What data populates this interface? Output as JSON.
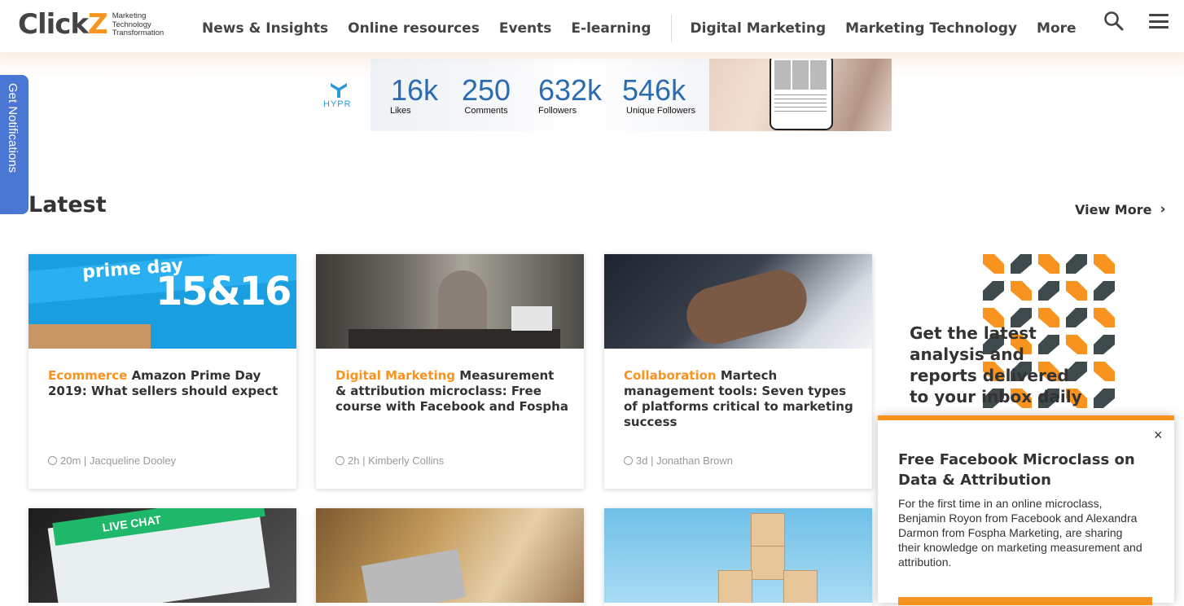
{
  "header": {
    "logo_text": "Click",
    "logo_z": "Z",
    "logo_tagline": [
      "Marketing",
      "Technology",
      "Transformation"
    ],
    "nav": [
      "News & Insights",
      "Online resources",
      "Events",
      "E-learning"
    ],
    "nav_secondary": [
      "Digital Marketing",
      "Marketing Technology",
      "More"
    ],
    "search_icon": "search-icon",
    "menu_icon": "hamburger-menu-icon"
  },
  "banner": {
    "brand": "HYPR",
    "stats": [
      {
        "value": "16k",
        "label": "Likes"
      },
      {
        "value": "250",
        "label": "Comments"
      },
      {
        "value": "632k",
        "label": "Followers"
      },
      {
        "value": "546k",
        "label": "Unique Followers"
      }
    ]
  },
  "notifications_tab": "Get Notifications",
  "section": {
    "title": "Latest",
    "view_more": "View More"
  },
  "cards": [
    {
      "category": "Ecommerce",
      "title": "Amazon Prime Day 2019: What sellers should expect",
      "age": "20m",
      "author": "Jacqueline Dooley"
    },
    {
      "category": "Digital Marketing",
      "title": "Measurement & attribution microclass: Free course with Facebook and Fospha",
      "age": "2h",
      "author": "Kimberly Collins"
    },
    {
      "category": "Collaboration",
      "title": "Martech management tools: Seven types of platforms critical to marketing success",
      "age": "3d",
      "author": "Jonathan Brown"
    }
  ],
  "card_images": {
    "prime_text_1": "prime day",
    "prime_text_2": "15&16",
    "chat_text": "LIVE CHAT"
  },
  "promo": {
    "text": "Get the latest analysis and reports delivered to your inbox daily"
  },
  "popup": {
    "close": "×",
    "title": "Free Facebook Microclass on Data & Attribution",
    "description": "For the first time in an online microclass, Benjamin Royon from Facebook and Alexandra Darmon from Fospha Marketing, are sharing their knowledge on marketing measurement and attribution."
  },
  "colors": {
    "accent": "#f7931e",
    "notify_tab": "#4a77d4",
    "stat_blue": "#2b6cb0"
  }
}
